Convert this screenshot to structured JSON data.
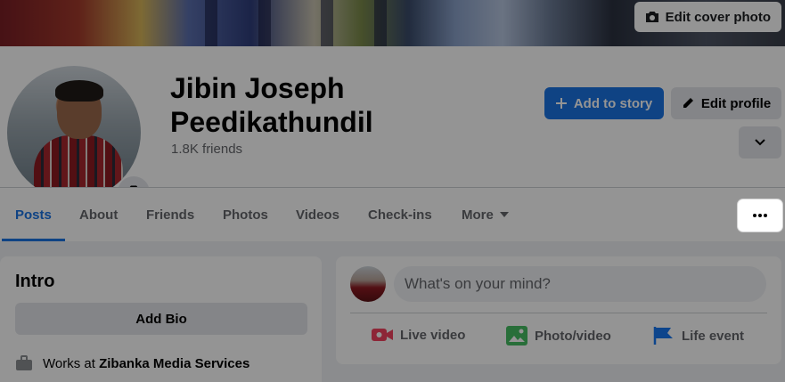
{
  "cover": {
    "edit_cover_label": "Edit cover photo"
  },
  "profile": {
    "name": "Jibin Joseph Peedikathundil",
    "friends": "1.8K friends"
  },
  "actions": {
    "add_to_story": "Add to story",
    "edit_profile": "Edit profile"
  },
  "tabs": [
    {
      "label": "Posts",
      "active": true
    },
    {
      "label": "About"
    },
    {
      "label": "Friends"
    },
    {
      "label": "Photos"
    },
    {
      "label": "Videos"
    },
    {
      "label": "Check-ins"
    },
    {
      "label": "More"
    }
  ],
  "intro": {
    "title": "Intro",
    "add_bio": "Add Bio",
    "work_prefix": "Works at",
    "work_company": "Zibanka Media Services"
  },
  "composer": {
    "placeholder": "What's on your mind?",
    "live_video": "Live video",
    "photo_video": "Photo/video",
    "life_event": "Life event"
  },
  "colors": {
    "accent": "#1b74e4",
    "live_red": "#f3425f",
    "photo_green": "#45bd62",
    "event_blue": "#1877f2"
  }
}
